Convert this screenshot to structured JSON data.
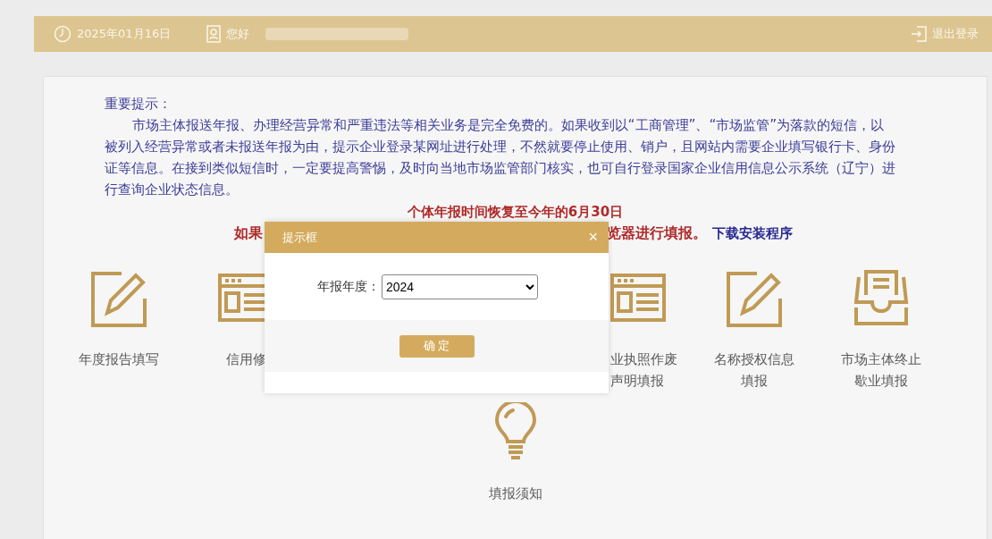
{
  "header": {
    "date": "2025年01月16日",
    "greeting": "您好",
    "logout": "退出登录"
  },
  "notice": {
    "title": "重要提示：",
    "body": "市场主体报送年报、办理经营异常和严重违法等相关业务是完全免费的。如果收到以“工商管理”、“市场监管”为落款的短信，以被列入经营异常或者未报送年报为由，提示企业登录某网址进行处理，不然就要停止使用、销户，且网站内需要企业填写银行卡、身份证等信息。在接到类似短信时，一定要提高警惕，及时向当地市场监管部门核实，也可自行登录国家企业信用信息公示系统（辽宁）进行查询企业状态信息。",
    "deadline": "个体年报时间恢复至今年的6月30日",
    "browser_left": "如果",
    "browser_right": "览器进行填报。",
    "download_link": "下载安装程序"
  },
  "features_left": [
    {
      "kind": "pencil",
      "lines": [
        "年度报告填写"
      ]
    },
    {
      "kind": "card",
      "lines": [
        "信用修"
      ]
    }
  ],
  "features_right": [
    {
      "kind": "card",
      "lines": [
        "业执照作废",
        "声明填报"
      ]
    },
    {
      "kind": "pencil",
      "lines": [
        "名称授权信息",
        "填报"
      ]
    },
    {
      "kind": "tray",
      "lines": [
        "市场主体终止",
        "歇业填报"
      ]
    }
  ],
  "features_bottom": [
    {
      "kind": "bulb",
      "lines": [
        "填报须知"
      ]
    }
  ],
  "dialog": {
    "title": "提示框",
    "close": "×",
    "field_label": "年报年度：",
    "value": "2024",
    "confirm": "确 定"
  }
}
